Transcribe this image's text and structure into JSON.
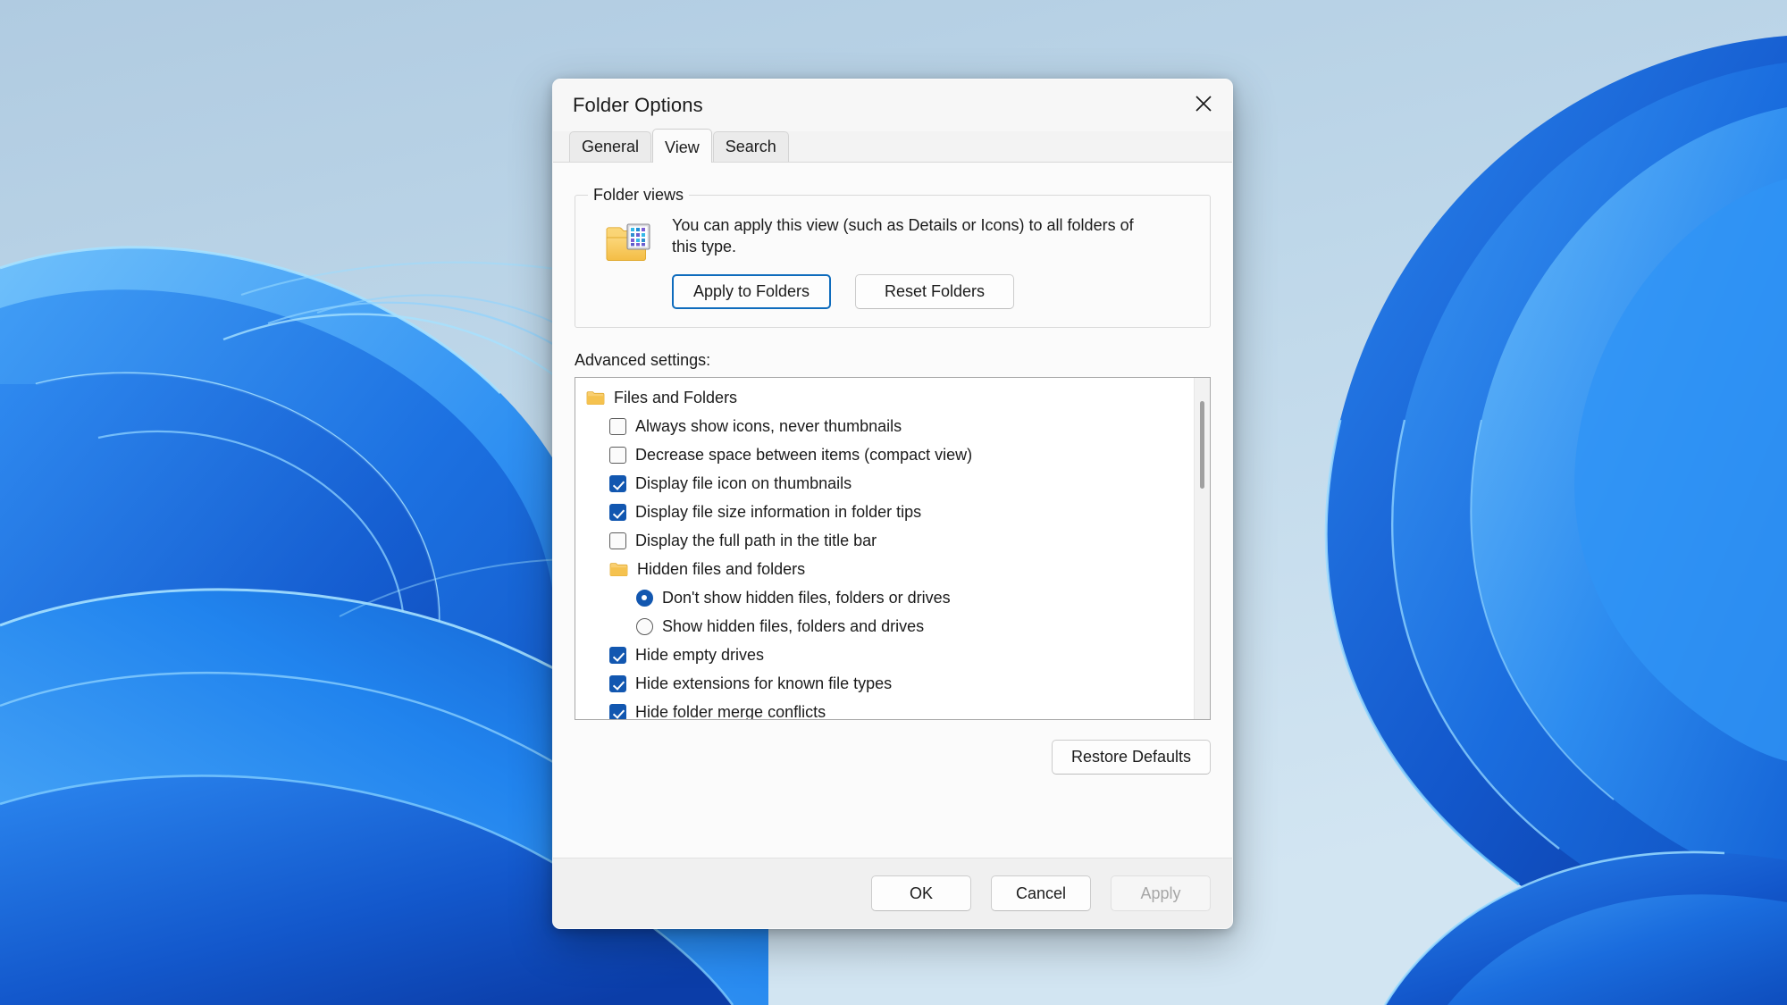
{
  "window": {
    "title": "Folder Options",
    "close_icon": "close-icon"
  },
  "tabs": [
    {
      "label": "General",
      "active": false
    },
    {
      "label": "View",
      "active": true
    },
    {
      "label": "Search",
      "active": false
    }
  ],
  "folder_views": {
    "legend": "Folder views",
    "icon": "folder-view-icon",
    "description": "You can apply this view (such as Details or Icons) to all folders of this type.",
    "apply_to_folders_label": "Apply to Folders",
    "reset_folders_label": "Reset Folders",
    "focused_button": "Apply to Folders"
  },
  "advanced": {
    "label": "Advanced settings:",
    "items": [
      {
        "type": "folder",
        "indent": 0,
        "label": "Files and Folders",
        "state": ""
      },
      {
        "type": "checkbox",
        "indent": 1,
        "label": "Always show icons, never thumbnails",
        "state": "unchecked"
      },
      {
        "type": "checkbox",
        "indent": 1,
        "label": "Decrease space between items (compact view)",
        "state": "unchecked"
      },
      {
        "type": "checkbox",
        "indent": 1,
        "label": "Display file icon on thumbnails",
        "state": "checked"
      },
      {
        "type": "checkbox",
        "indent": 1,
        "label": "Display file size information in folder tips",
        "state": "checked"
      },
      {
        "type": "checkbox",
        "indent": 1,
        "label": "Display the full path in the title bar",
        "state": "unchecked"
      },
      {
        "type": "folder",
        "indent": 1,
        "label": "Hidden files and folders",
        "state": ""
      },
      {
        "type": "radio",
        "indent": 2,
        "label": "Don't show hidden files, folders or drives",
        "state": "selected"
      },
      {
        "type": "radio",
        "indent": 2,
        "label": "Show hidden files, folders and drives",
        "state": "unselected"
      },
      {
        "type": "checkbox",
        "indent": 1,
        "label": "Hide empty drives",
        "state": "checked"
      },
      {
        "type": "checkbox",
        "indent": 1,
        "label": "Hide extensions for known file types",
        "state": "checked"
      },
      {
        "type": "checkbox",
        "indent": 1,
        "label": "Hide folder merge conflicts",
        "state": "checked"
      }
    ],
    "scrollbar": {
      "position": "near-top"
    }
  },
  "restore_defaults_label": "Restore Defaults",
  "footer": {
    "ok_label": "OK",
    "cancel_label": "Cancel",
    "apply_label": "Apply",
    "apply_disabled": true
  },
  "colors": {
    "accent_blue": "#1257b0",
    "focus_blue": "#0f6cbd",
    "dialog_bg": "#f3f3f3",
    "page_bg": "#fbfbfb",
    "folder_yellow": "#f7c14b",
    "wallpaper_sky": "#bad4e7",
    "wallpaper_blue": "#1a7ef0"
  },
  "desktop": {
    "wallpaper": "windows-11-bloom-wallpaper"
  }
}
